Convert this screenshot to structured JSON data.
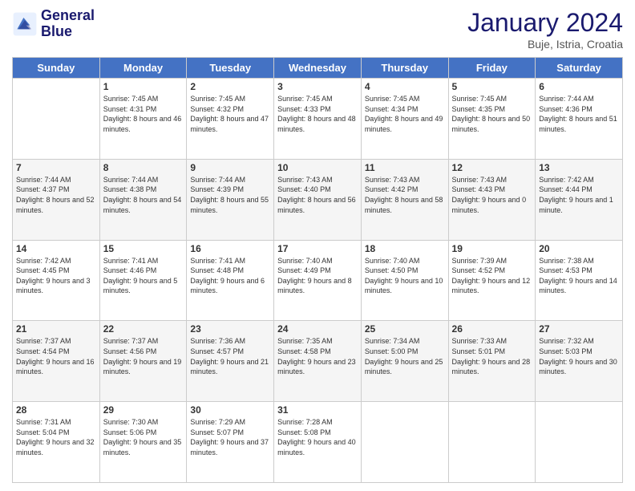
{
  "logo": {
    "line1": "General",
    "line2": "Blue"
  },
  "header": {
    "title": "January 2024",
    "subtitle": "Buje, Istria, Croatia"
  },
  "weekdays": [
    "Sunday",
    "Monday",
    "Tuesday",
    "Wednesday",
    "Thursday",
    "Friday",
    "Saturday"
  ],
  "weeks": [
    [
      {
        "day": "",
        "sunrise": "",
        "sunset": "",
        "daylight": ""
      },
      {
        "day": "1",
        "sunrise": "7:45 AM",
        "sunset": "4:31 PM",
        "daylight": "8 hours and 46 minutes."
      },
      {
        "day": "2",
        "sunrise": "7:45 AM",
        "sunset": "4:32 PM",
        "daylight": "8 hours and 47 minutes."
      },
      {
        "day": "3",
        "sunrise": "7:45 AM",
        "sunset": "4:33 PM",
        "daylight": "8 hours and 48 minutes."
      },
      {
        "day": "4",
        "sunrise": "7:45 AM",
        "sunset": "4:34 PM",
        "daylight": "8 hours and 49 minutes."
      },
      {
        "day": "5",
        "sunrise": "7:45 AM",
        "sunset": "4:35 PM",
        "daylight": "8 hours and 50 minutes."
      },
      {
        "day": "6",
        "sunrise": "7:44 AM",
        "sunset": "4:36 PM",
        "daylight": "8 hours and 51 minutes."
      }
    ],
    [
      {
        "day": "7",
        "sunrise": "7:44 AM",
        "sunset": "4:37 PM",
        "daylight": "8 hours and 52 minutes."
      },
      {
        "day": "8",
        "sunrise": "7:44 AM",
        "sunset": "4:38 PM",
        "daylight": "8 hours and 54 minutes."
      },
      {
        "day": "9",
        "sunrise": "7:44 AM",
        "sunset": "4:39 PM",
        "daylight": "8 hours and 55 minutes."
      },
      {
        "day": "10",
        "sunrise": "7:43 AM",
        "sunset": "4:40 PM",
        "daylight": "8 hours and 56 minutes."
      },
      {
        "day": "11",
        "sunrise": "7:43 AM",
        "sunset": "4:42 PM",
        "daylight": "8 hours and 58 minutes."
      },
      {
        "day": "12",
        "sunrise": "7:43 AM",
        "sunset": "4:43 PM",
        "daylight": "9 hours and 0 minutes."
      },
      {
        "day": "13",
        "sunrise": "7:42 AM",
        "sunset": "4:44 PM",
        "daylight": "9 hours and 1 minute."
      }
    ],
    [
      {
        "day": "14",
        "sunrise": "7:42 AM",
        "sunset": "4:45 PM",
        "daylight": "9 hours and 3 minutes."
      },
      {
        "day": "15",
        "sunrise": "7:41 AM",
        "sunset": "4:46 PM",
        "daylight": "9 hours and 5 minutes."
      },
      {
        "day": "16",
        "sunrise": "7:41 AM",
        "sunset": "4:48 PM",
        "daylight": "9 hours and 6 minutes."
      },
      {
        "day": "17",
        "sunrise": "7:40 AM",
        "sunset": "4:49 PM",
        "daylight": "9 hours and 8 minutes."
      },
      {
        "day": "18",
        "sunrise": "7:40 AM",
        "sunset": "4:50 PM",
        "daylight": "9 hours and 10 minutes."
      },
      {
        "day": "19",
        "sunrise": "7:39 AM",
        "sunset": "4:52 PM",
        "daylight": "9 hours and 12 minutes."
      },
      {
        "day": "20",
        "sunrise": "7:38 AM",
        "sunset": "4:53 PM",
        "daylight": "9 hours and 14 minutes."
      }
    ],
    [
      {
        "day": "21",
        "sunrise": "7:37 AM",
        "sunset": "4:54 PM",
        "daylight": "9 hours and 16 minutes."
      },
      {
        "day": "22",
        "sunrise": "7:37 AM",
        "sunset": "4:56 PM",
        "daylight": "9 hours and 19 minutes."
      },
      {
        "day": "23",
        "sunrise": "7:36 AM",
        "sunset": "4:57 PM",
        "daylight": "9 hours and 21 minutes."
      },
      {
        "day": "24",
        "sunrise": "7:35 AM",
        "sunset": "4:58 PM",
        "daylight": "9 hours and 23 minutes."
      },
      {
        "day": "25",
        "sunrise": "7:34 AM",
        "sunset": "5:00 PM",
        "daylight": "9 hours and 25 minutes."
      },
      {
        "day": "26",
        "sunrise": "7:33 AM",
        "sunset": "5:01 PM",
        "daylight": "9 hours and 28 minutes."
      },
      {
        "day": "27",
        "sunrise": "7:32 AM",
        "sunset": "5:03 PM",
        "daylight": "9 hours and 30 minutes."
      }
    ],
    [
      {
        "day": "28",
        "sunrise": "7:31 AM",
        "sunset": "5:04 PM",
        "daylight": "9 hours and 32 minutes."
      },
      {
        "day": "29",
        "sunrise": "7:30 AM",
        "sunset": "5:06 PM",
        "daylight": "9 hours and 35 minutes."
      },
      {
        "day": "30",
        "sunrise": "7:29 AM",
        "sunset": "5:07 PM",
        "daylight": "9 hours and 37 minutes."
      },
      {
        "day": "31",
        "sunrise": "7:28 AM",
        "sunset": "5:08 PM",
        "daylight": "9 hours and 40 minutes."
      },
      {
        "day": "",
        "sunrise": "",
        "sunset": "",
        "daylight": ""
      },
      {
        "day": "",
        "sunrise": "",
        "sunset": "",
        "daylight": ""
      },
      {
        "day": "",
        "sunrise": "",
        "sunset": "",
        "daylight": ""
      }
    ]
  ],
  "labels": {
    "sunrise": "Sunrise:",
    "sunset": "Sunset:",
    "daylight": "Daylight:"
  }
}
